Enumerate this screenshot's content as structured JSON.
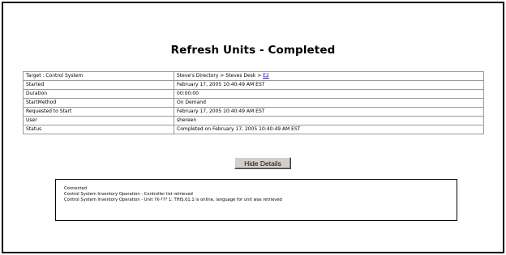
{
  "page": {
    "title": "Refresh Units - Completed"
  },
  "details": {
    "target_label": "Target : Control System",
    "target_path": "Steve's Directory > Steves Desk > ",
    "target_link": "E2",
    "rows": [
      {
        "label": "Started",
        "value": "February 17, 2005 10:40:49 AM EST"
      },
      {
        "label": "Duration",
        "value": "00:00:00"
      },
      {
        "label": "StartMethod",
        "value": "On Demand"
      },
      {
        "label": "Requested to Start",
        "value": "February 17, 2005 10:40:49 AM EST"
      },
      {
        "label": "User",
        "value": "shereen"
      },
      {
        "label": "Status",
        "value": "Completed on February 17, 2005 10:40:49 AM EST"
      }
    ]
  },
  "button": {
    "hide_details": "Hide Details"
  },
  "log": {
    "lines": [
      "Connected",
      "Control System Inventory Operation - Controller list retrieved",
      "Control System Inventory Operation - Unit ?X-??? 1: THIS.01.1 is online, language for unit was retrieved"
    ]
  },
  "colors": {
    "link": "#0000cc",
    "button_face": "#d4d0c8",
    "border": "#000000"
  }
}
